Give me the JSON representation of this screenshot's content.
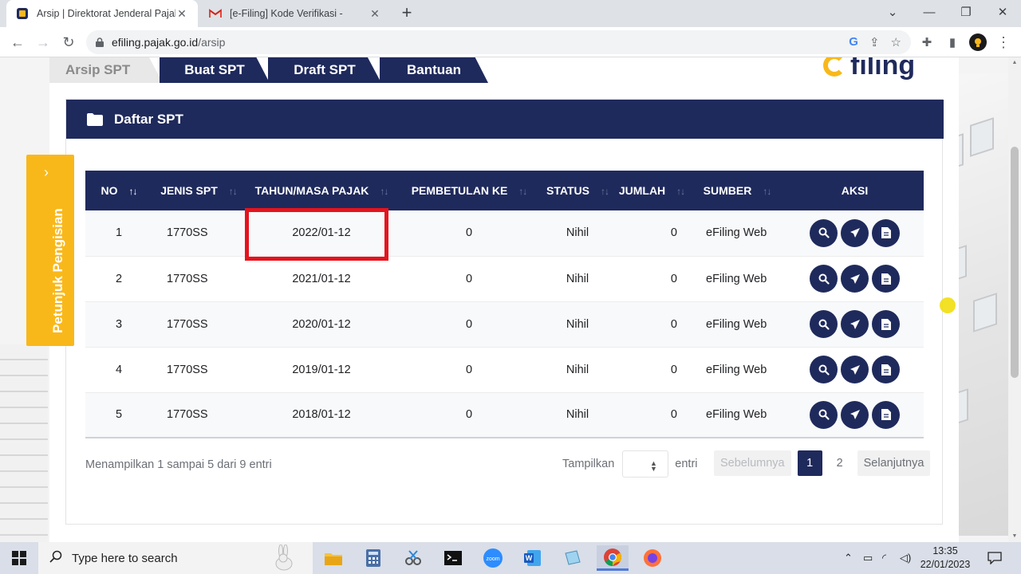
{
  "browser": {
    "tabs": [
      {
        "title": "Arsip | Direktorat Jenderal Pajak",
        "close": "✕"
      },
      {
        "title": "[e-Filing] Kode Verifikasi -",
        "close": "✕"
      }
    ],
    "url_host": "efiling.pajak.go.id",
    "url_path": "/arsip"
  },
  "page": {
    "top_tabs": [
      "Arsip SPT",
      "Buat SPT",
      "Draft SPT",
      "Bantuan"
    ],
    "logo_text": "filing",
    "panel_title": "Daftar SPT",
    "side_tab_label": "Petunjuk Pengisian",
    "table": {
      "columns": [
        "NO",
        "JENIS SPT",
        "TAHUN/MASA PAJAK",
        "PEMBETULAN KE",
        "STATUS",
        "JUMLAH",
        "SUMBER",
        "AKSI"
      ],
      "rows": [
        {
          "no": "1",
          "jenis": "1770SS",
          "tahun": "2022/01-12",
          "pembetulan": "0",
          "status": "Nihil",
          "jumlah": "0",
          "sumber": "eFiling Web"
        },
        {
          "no": "2",
          "jenis": "1770SS",
          "tahun": "2021/01-12",
          "pembetulan": "0",
          "status": "Nihil",
          "jumlah": "0",
          "sumber": "eFiling Web"
        },
        {
          "no": "3",
          "jenis": "1770SS",
          "tahun": "2020/01-12",
          "pembetulan": "0",
          "status": "Nihil",
          "jumlah": "0",
          "sumber": "eFiling Web"
        },
        {
          "no": "4",
          "jenis": "1770SS",
          "tahun": "2019/01-12",
          "pembetulan": "0",
          "status": "Nihil",
          "jumlah": "0",
          "sumber": "eFiling Web"
        },
        {
          "no": "5",
          "jenis": "1770SS",
          "tahun": "2018/01-12",
          "pembetulan": "0",
          "status": "Nihil",
          "jumlah": "0",
          "sumber": "eFiling Web"
        }
      ]
    },
    "info_text": "Menampilkan 1 sampai 5 dari 9 entri",
    "length_label_before": "Tampilkan",
    "length_label_after": "entri",
    "pager": {
      "prev": "Sebelumnya",
      "pages": [
        "1",
        "2"
      ],
      "next": "Selanjutnya",
      "current": "1"
    }
  },
  "taskbar": {
    "search_placeholder": "Type here to search",
    "time": "13:35",
    "date": "22/01/2023"
  },
  "colors": {
    "navy": "#1f2a5c",
    "accent_yellow": "#f9b81a",
    "highlight_red": "#e5131d"
  }
}
